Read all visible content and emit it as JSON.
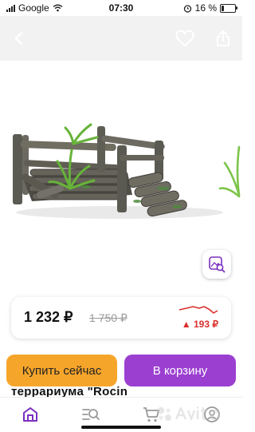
{
  "status_bar": {
    "carrier": "Google",
    "time": "07:30",
    "battery": "16 %",
    "battery_level": 0.16
  },
  "header": {
    "icons": [
      "back-icon",
      "heart-icon",
      "share-icon"
    ]
  },
  "gallery": {
    "icons": [
      "visual-search-icon"
    ]
  },
  "price_card": {
    "price": "1 232 ₽",
    "old_price": "1 750 ₽",
    "change": "▲ 193 ₽",
    "trend_color": "#d9302c"
  },
  "listing": {
    "title_peek": "террариума \"Rocin"
  },
  "actions": {
    "buy_now": "Купить сейчас",
    "add_to_cart": "В корзину"
  },
  "colors": {
    "buy_button": "#f6a52b",
    "cart_button": "#9b3fd1",
    "nav_active": "#7b2fbf"
  },
  "tabbar": {
    "icons": [
      "home-icon",
      "search-icon",
      "cart-icon",
      "profile-icon"
    ],
    "brand_watermark": "Avito"
  }
}
